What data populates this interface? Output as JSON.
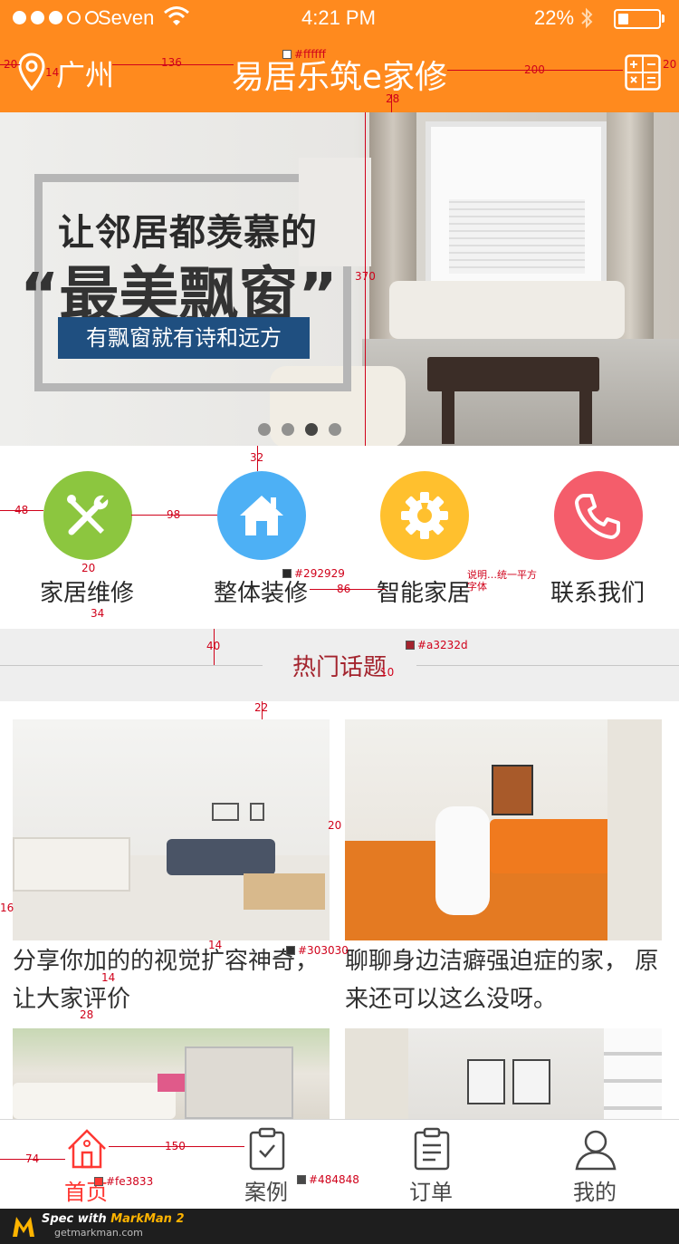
{
  "status_bar": {
    "carrier": "Seven",
    "time": "4:21 PM",
    "battery": "22%"
  },
  "header": {
    "city": "广州",
    "title": "易居乐筑e家修",
    "icons": [
      "location-pin-icon",
      "calculator-icon"
    ],
    "background": "#ff8a1e"
  },
  "banner": {
    "headline": "让邻居都羡慕的",
    "highlight": "“最美飘窗”",
    "tagline": "有飘窗就有诗和远方",
    "slide_count": 4,
    "active_slide": 3
  },
  "categories": [
    {
      "label": "家居维修",
      "icon": "tools-icon",
      "color": "#8cc63f"
    },
    {
      "label": "整体装修",
      "icon": "house-icon",
      "color": "#4db0f5"
    },
    {
      "label": "智能家居",
      "icon": "gear-icon",
      "color": "#ffc02e"
    },
    {
      "label": "联系我们",
      "icon": "phone-icon",
      "color": "#f45d6b"
    }
  ],
  "section": {
    "title": "热门话题"
  },
  "topics": [
    {
      "caption": "分享你加的的视觉扩容神奇，让大家评价"
    },
    {
      "caption": "聊聊身边洁癖强迫症的家， 原来还可以这么没呀。"
    },
    {
      "caption": ""
    },
    {
      "caption": ""
    }
  ],
  "tabbar": {
    "items": [
      {
        "label": "首页",
        "icon": "home-icon",
        "active": true
      },
      {
        "label": "案例",
        "icon": "clipboard-check-icon",
        "active": false
      },
      {
        "label": "订单",
        "icon": "clipboard-list-icon",
        "active": false
      },
      {
        "label": "我的",
        "icon": "user-icon",
        "active": false
      }
    ],
    "active_color": "#fe3833",
    "inactive_color": "#484848"
  },
  "footer": {
    "prefix": "Spec with",
    "brand": "MarkMan 2",
    "url": "getmarkman.com"
  },
  "annotations": {
    "header_left_pad": "20",
    "icon_text_gap": "14",
    "city_title_gap": "136",
    "title_color": "#ffffff",
    "title_right_gap": "200",
    "header_right_pad": "20",
    "banner_top": "28",
    "banner_height": "370",
    "icon_top_gap": "32",
    "icon_left_pad": "48",
    "icon_gap": "98",
    "icon_label_gap": "20",
    "label_color": "#292929",
    "label_gap": "86",
    "font_note": "说明…统一平方字体",
    "label_bottom": "34",
    "section_height": "40",
    "section_color": "#a3232d",
    "section_line_gap": "10",
    "card_top": "22",
    "card_gap": "20",
    "card_left": "16",
    "card_text_top": "14",
    "card_text_color": "#303030",
    "card_line_gap": "14",
    "card_bottom": "28",
    "tab_left": "74",
    "tab_gap": "150",
    "tab_active_color": "#fe3833",
    "tab_inactive_color": "#484848"
  }
}
